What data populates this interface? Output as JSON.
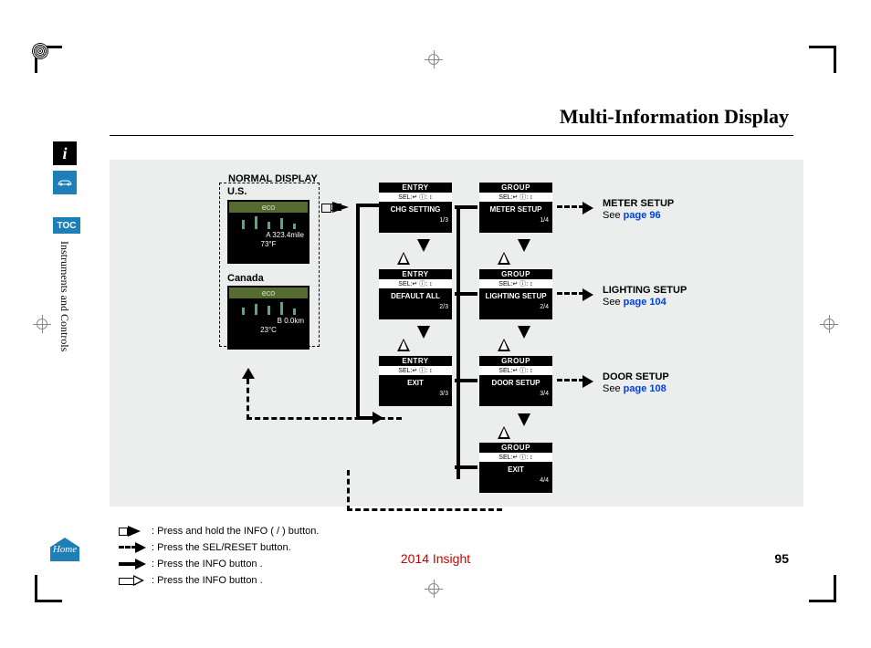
{
  "title": "Multi-Information Display",
  "side": {
    "toc": "TOC",
    "section": "Instruments and Controls",
    "home": "Home"
  },
  "diagram": {
    "normal_display": "NORMAL DISPLAY",
    "us": "U.S.",
    "canada": "Canada",
    "eco": "eco",
    "us_trip": "A   323.4mile",
    "us_temp": "73°F",
    "ca_trip": "B   0.0km",
    "ca_temp": "23°C",
    "entry": {
      "head": "ENTRY",
      "sel": "SEL:↵  ⓘ: ↕",
      "items": [
        "CHG SETTING",
        "DEFAULT ALL",
        "EXIT"
      ],
      "pages": [
        "1/3",
        "2/3",
        "3/3"
      ]
    },
    "group": {
      "head": "GROUP",
      "sel": "SEL:↵  ⓘ: ↕",
      "items": [
        "METER SETUP",
        "LIGHTING SETUP",
        "DOOR SETUP",
        "EXIT"
      ],
      "pages": [
        "1/4",
        "2/4",
        "3/4",
        "4/4"
      ]
    },
    "setups": [
      {
        "name": "METER SETUP",
        "see": "See ",
        "link": "page 96"
      },
      {
        "name": "LIGHTING SETUP",
        "see": "See ",
        "link": "page 104"
      },
      {
        "name": "DOOR SETUP",
        "see": "See ",
        "link": "page 108"
      }
    ]
  },
  "legend": {
    "l1": ": Press and hold the INFO (   /   ) button.",
    "l2": ": Press the SEL/RESET button.",
    "l3": ": Press the INFO button   .",
    "l4": ": Press the INFO button   ."
  },
  "footer": {
    "model": "2014 Insight",
    "page": "95"
  }
}
